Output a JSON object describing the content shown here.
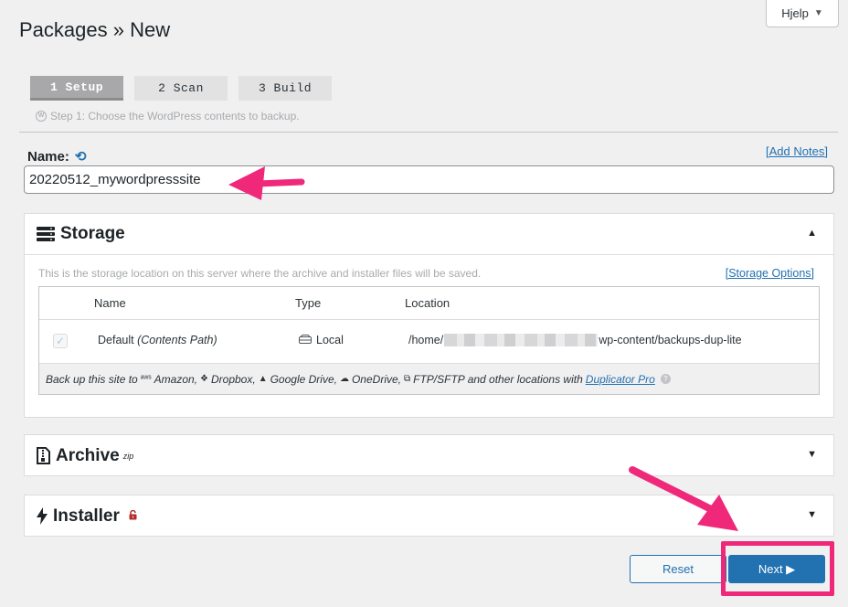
{
  "help": {
    "label": "Hjelp",
    "caret": "▼"
  },
  "page": {
    "title": "Packages » New"
  },
  "steps": [
    {
      "label": "1 Setup"
    },
    {
      "label": "2 Scan"
    },
    {
      "label": "3 Build"
    }
  ],
  "step_description": "Step 1: Choose the WordPress contents to backup.",
  "name_field": {
    "label": "Name:",
    "value": "20220512_mywordpresssite",
    "add_notes": "[Add Notes]"
  },
  "storage": {
    "title": "Storage",
    "toggle": "▲",
    "description": "This is the storage location on this server where the archive and installer files will be saved.",
    "options_link": "[Storage Options]",
    "columns": {
      "name": "Name",
      "type": "Type",
      "location": "Location"
    },
    "row": {
      "checked": true,
      "name": "Default",
      "name_note": "(Contents Path)",
      "type": "Local",
      "location_prefix": "/home/",
      "location_suffix": "wp-content/backups-dup-lite"
    },
    "footer": {
      "lead": "Back up this site to",
      "amazon": "Amazon,",
      "dropbox": "Dropbox,",
      "gdrive": "Google Drive,",
      "onedrive": "OneDrive,",
      "ftp": "FTP/SFTP and other locations with",
      "pro_link": "Duplicator Pro"
    }
  },
  "archive": {
    "title": "Archive",
    "sup": "zip",
    "toggle": "▼"
  },
  "installer": {
    "title": "Installer",
    "toggle": "▼"
  },
  "buttons": {
    "reset": "Reset",
    "next": "Next ▶"
  },
  "colors": {
    "accent": "#2271b1",
    "annotation": "#f0287a",
    "locked": "#b32d2e"
  }
}
